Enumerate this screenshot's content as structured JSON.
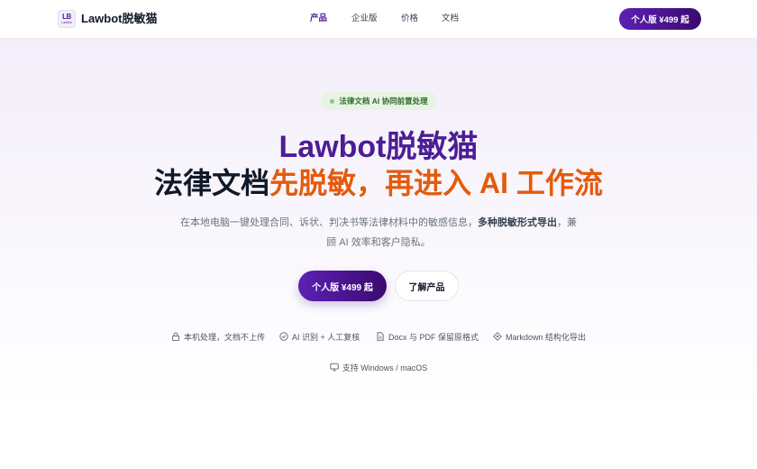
{
  "header": {
    "logo_mark": "LB",
    "logo_small": "Lawbot",
    "brand": "Lawbot脱敏猫",
    "nav": [
      {
        "label": "产品",
        "active": true
      },
      {
        "label": "企业版",
        "active": false
      },
      {
        "label": "价格",
        "active": false
      },
      {
        "label": "文档",
        "active": false
      }
    ],
    "cta_label": "个人版 ¥499 起"
  },
  "hero": {
    "badge": "法律文档 AI 协同前置处理",
    "title_line1": "Lawbot脱敏猫",
    "title_line2_a": "法律文档",
    "title_line2_b": "先脱敏，再进入 AI 工作流",
    "desc_a": "在本地电脑一键处理合同、诉状、判决书等法律材料中的敏感信息，",
    "desc_b": "多种脱敏形式导出",
    "desc_c": "，兼顾 AI 效率和客户隐私。",
    "primary_button": "个人版 ¥499 起",
    "secondary_button": "了解产品"
  },
  "features": [
    {
      "icon": "lock-icon",
      "label": "本机处理，文档不上传"
    },
    {
      "icon": "check-circle-icon",
      "label": "AI 识别 + 人工复核"
    },
    {
      "icon": "document-icon",
      "label": "Docx 与 PDF 保留原格式"
    },
    {
      "icon": "diamond-icon",
      "label": "Markdown 结构化导出"
    }
  ],
  "platform": {
    "icon": "monitor-icon",
    "label": "支持 Windows / macOS"
  },
  "colors": {
    "brand_purple": "#4c1d95",
    "accent_orange": "#e35b0e",
    "badge_green": "#2f6b2c"
  }
}
